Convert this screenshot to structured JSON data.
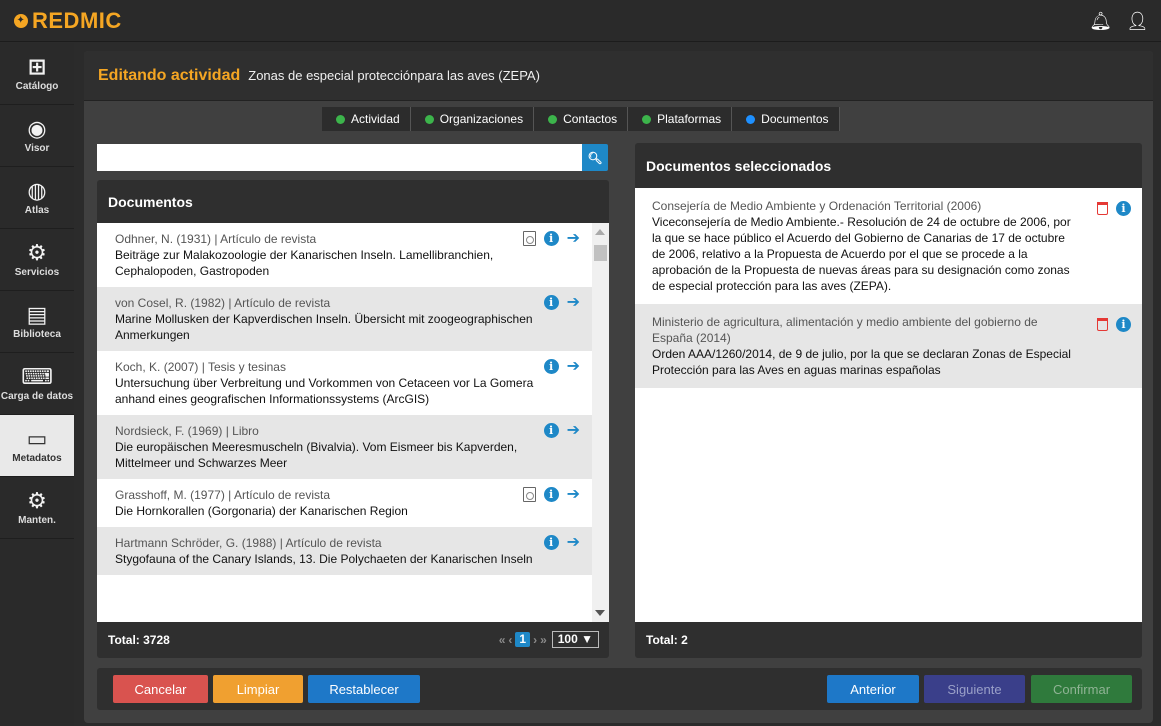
{
  "app": {
    "logo": "REDMIC"
  },
  "sidebar": {
    "items": [
      {
        "label": "Catálogo",
        "icon": "sitemap-icon",
        "glyph": "⊞"
      },
      {
        "label": "Visor",
        "icon": "eye-icon",
        "glyph": "◉"
      },
      {
        "label": "Atlas",
        "icon": "globe-icon",
        "glyph": "◍"
      },
      {
        "label": "Servicios",
        "icon": "services-icon",
        "glyph": "⚙"
      },
      {
        "label": "Biblioteca",
        "icon": "book-icon",
        "glyph": "▤"
      },
      {
        "label": "Carga de datos",
        "icon": "keyboard-icon",
        "glyph": "⌨"
      },
      {
        "label": "Metadatos",
        "icon": "archive-icon",
        "glyph": "▭"
      },
      {
        "label": "Manten.",
        "icon": "cogs-icon",
        "glyph": "⚙"
      }
    ]
  },
  "header": {
    "title": "Editando actividad",
    "subtitle": "Zonas de especial protecciónpara las aves (ZEPA)"
  },
  "steps": [
    {
      "label": "Actividad",
      "color": "#3cb44b"
    },
    {
      "label": "Organizaciones",
      "color": "#3cb44b"
    },
    {
      "label": "Contactos",
      "color": "#3cb44b"
    },
    {
      "label": "Plataformas",
      "color": "#3cb44b"
    },
    {
      "label": "Documentos",
      "color": "#1e90ff"
    }
  ],
  "search": {
    "value": "",
    "placeholder": ""
  },
  "documents": {
    "title": "Documentos",
    "total": "Total: 3728",
    "page": "1",
    "page_size": "100",
    "rows": [
      {
        "meta": "Odhner, N. (1931) | Artículo de revista",
        "title": "Beiträge zur Malakozoologie der Kanarischen Inseln. Lamellibranchien, Cephalopoden, Gastropoden"
      },
      {
        "meta": "von Cosel, R. (1982) | Artículo de revista",
        "title": "Marine Mollusken der Kapverdischen Inseln. Übersicht mit zoogeographischen Anmerkungen"
      },
      {
        "meta": "Koch, K. (2007) | Tesis y tesinas",
        "title": "Untersuchung über Verbreitung und Vorkommen von Cetaceen vor La Gomera anhand eines geografischen Informationssystems (ArcGIS)"
      },
      {
        "meta": "Nordsieck, F. (1969) | Libro",
        "title": "Die europäischen Meeresmuscheln (Bivalvia). Vom Eismeer bis Kapverden, Mittelmeer und Schwarzes Meer"
      },
      {
        "meta": "Grasshoff, M. (1977) | Artículo de revista",
        "title": "Die Hornkorallen (Gorgonaria) der Kanarischen Region"
      },
      {
        "meta": "Hartmann Schröder, G. (1988) | Artículo de revista",
        "title": "Stygofauna of the Canary Islands, 13. Die Polychaeten der Kanarischen Inseln"
      }
    ]
  },
  "selected": {
    "title": "Documentos seleccionados",
    "total": "Total: 2",
    "rows": [
      {
        "meta": "Consejería de Medio Ambiente y Ordenación Territorial (2006)",
        "title": "Viceconsejería de Medio Ambiente.- Resolución de 24 de octubre de 2006, por la que se hace público el Acuerdo del Gobierno de Canarias de 17 de octubre de 2006, relativo a la Propuesta de Acuerdo por el que se procede a la aprobación de la Propuesta de nuevas áreas para su designación como zonas de especial protección para las aves (ZEPA)."
      },
      {
        "meta": "Ministerio de agricultura, alimentación y medio ambiente del gobierno de España (2014)",
        "title": "Orden AAA/1260/2014, de 9 de julio, por la que se declaran Zonas de Especial Protección para las Aves en aguas marinas españolas"
      }
    ]
  },
  "buttons": {
    "cancel": "Cancelar",
    "clear": "Limpiar",
    "reset": "Restablecer",
    "prev": "Anterior",
    "next": "Siguiente",
    "confirm": "Confirmar"
  }
}
